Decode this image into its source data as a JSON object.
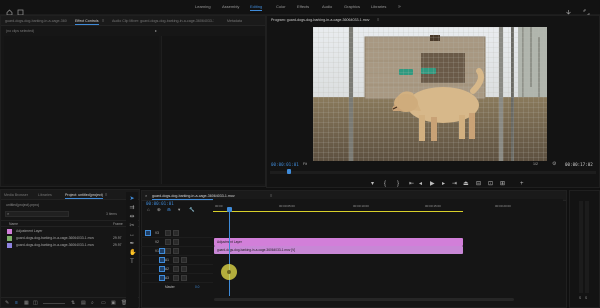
{
  "workspaces": {
    "items": [
      {
        "label": "Learning",
        "active": false
      },
      {
        "label": "Assembly",
        "active": false
      },
      {
        "label": "Editing",
        "active": true
      },
      {
        "label": "Color",
        "active": false
      },
      {
        "label": "Effects",
        "active": false
      },
      {
        "label": "Audio",
        "active": false
      },
      {
        "label": "Graphics",
        "active": false
      },
      {
        "label": "Libraries",
        "active": false
      }
    ]
  },
  "source_panel": {
    "tabs": [
      {
        "label": "guard-dogs-dog-barking-in-a-cage-36064033-1.mov",
        "active": false
      },
      {
        "label": "Effect Controls",
        "active": true
      },
      {
        "label": "Audio Clip Mixer: guard-dogs-dog-barking-in-a-cage-36064033-1.mov",
        "active": false
      },
      {
        "label": "Metadata",
        "active": false
      }
    ],
    "clip_label": "(no clips selected)"
  },
  "program_monitor": {
    "title": "Program: guard-dogs-dog-barking-in-a-cage-36064033-1.mov",
    "timecode_current": "00:00:01:01",
    "fit": "Fit",
    "resolution": "1/2",
    "timecode_duration": "00:00:17:02"
  },
  "project_panel": {
    "tabs": [
      {
        "label": "Media Browser",
        "active": false
      },
      {
        "label": "Libraries",
        "active": false
      },
      {
        "label": "Project: untitled(project)",
        "active": true
      }
    ],
    "path": "untitled(project).prproj",
    "search_placeholder": "",
    "item_count": "3 items",
    "col_name": "Name",
    "col_framerate": "Frame",
    "items": [
      {
        "label": "Adjustment Layer",
        "color": "#d27fd9",
        "rate": ""
      },
      {
        "label": "guard-dogs-dog-barking-in-a-cage-36064033-1.mov",
        "color": "#7fb06a",
        "rate": "29.97"
      },
      {
        "label": "guard-dogs-dog-barking-in-a-cage-36064033-1.mov",
        "color": "#8e84e0",
        "rate": "29.97"
      }
    ]
  },
  "timeline": {
    "tab_label": "guard-dogs-dog-barking-in-a-cage-36064033-1.mov",
    "timecode": "00:00:01:01",
    "ruler": [
      "00:00",
      "00:00:05:00",
      "00:00:10:00",
      "00:00:15:00",
      "00:00:20:00"
    ],
    "tracks": [
      {
        "name": "V3",
        "kind": "video"
      },
      {
        "name": "V2",
        "kind": "video"
      },
      {
        "name": "V1",
        "kind": "video"
      },
      {
        "name": "A1",
        "kind": "audio"
      },
      {
        "name": "A2",
        "kind": "audio"
      },
      {
        "name": "A3",
        "kind": "audio"
      },
      {
        "name": "Master",
        "kind": "master"
      }
    ],
    "clips": [
      {
        "label": "Adjustment Layer",
        "track": "V2",
        "color": "#d27fd9"
      },
      {
        "label": "guard-dogs-dog-barking-in-a-cage-36064033-1.mov [V]",
        "track": "V1",
        "color": "#d68be0"
      }
    ],
    "master_value": "0.0"
  },
  "audio_meter": {
    "labels": [
      "S",
      "S"
    ]
  },
  "colors": {
    "accent": "#3f8bd9",
    "playhead": "#3f8bd9",
    "workarea": "#d8d02a",
    "cursor": "#e8e04a"
  }
}
